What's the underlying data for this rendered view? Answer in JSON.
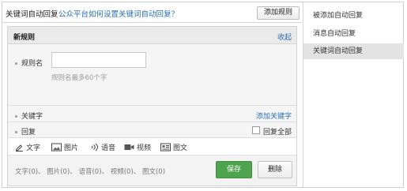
{
  "header": {
    "title": "关键词自动回复",
    "help_link": "公众平台如何设置关键词自动回复？",
    "add_rule_button": "添加规则"
  },
  "rule": {
    "name": "新规则",
    "collapse_link": "收起",
    "rule_name_label": "规则名",
    "rule_name_value": "",
    "rule_name_hint": "规则名最多60个字",
    "keyword_label": "关键字",
    "add_keyword_link": "添加关键字",
    "reply_label": "回复",
    "reply_all_label": "回复全部",
    "reply_all_checked": false
  },
  "toolbar": {
    "items": [
      {
        "label": "文字",
        "icon": "pencil-icon"
      },
      {
        "label": "图片",
        "icon": "image-icon"
      },
      {
        "label": "语音",
        "icon": "voice-icon"
      },
      {
        "label": "视频",
        "icon": "video-icon"
      },
      {
        "label": "图文",
        "icon": "article-icon"
      }
    ]
  },
  "footer": {
    "counts": "文字(0)、 图片(0)、 语音(0)、 视频(0)、 图文(0)",
    "save_button": "保存",
    "delete_button": "删除"
  },
  "sidebar": {
    "items": [
      {
        "label": "被添加自动回复",
        "active": false
      },
      {
        "label": "消息自动回复",
        "active": false
      },
      {
        "label": "关键词自动回复",
        "active": true
      }
    ]
  },
  "colors": {
    "link": "#2a6fb5",
    "save_button": "#4ea34e",
    "active_sidebar": "#e3e3e3"
  }
}
